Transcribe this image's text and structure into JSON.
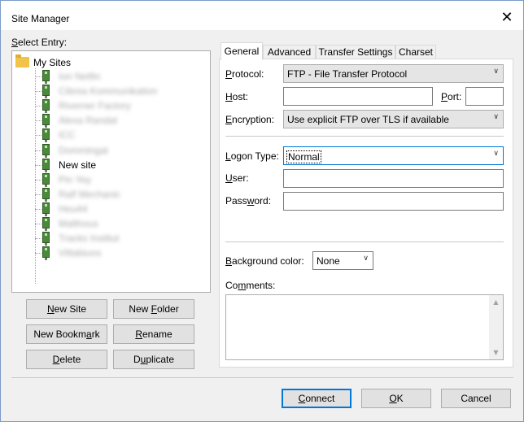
{
  "window": {
    "title": "Site Manager"
  },
  "tree": {
    "label": "Select Entry:",
    "root": "My Sites",
    "items": [
      {
        "label": "Ion Netfin",
        "blurred": true
      },
      {
        "label": "Cibrea Kommunikation",
        "blurred": true
      },
      {
        "label": "Riverner Factory",
        "blurred": true
      },
      {
        "label": "Alexa Randat",
        "blurred": true
      },
      {
        "label": "ICC",
        "blurred": true
      },
      {
        "label": "Dommingal",
        "blurred": true
      },
      {
        "label": "New site",
        "blurred": false
      },
      {
        "label": "Pin Yey",
        "blurred": true
      },
      {
        "label": "Ralf Mechanic",
        "blurred": true
      },
      {
        "label": "Heu44",
        "blurred": true
      },
      {
        "label": "Malthous",
        "blurred": true
      },
      {
        "label": "Tracks Institut",
        "blurred": true
      },
      {
        "label": "Vittabiuos",
        "blurred": true
      }
    ]
  },
  "left_buttons": {
    "new_site": "New Site",
    "new_folder": "New Folder",
    "new_bookmark": "New Bookmark",
    "rename": "Rename",
    "delete": "Delete",
    "duplicate": "Duplicate"
  },
  "tabs": [
    "General",
    "Advanced",
    "Transfer Settings",
    "Charset"
  ],
  "general": {
    "protocol_label": "Protocol:",
    "protocol_value": "FTP - File Transfer Protocol",
    "host_label": "Host:",
    "host_value": "",
    "port_label": "Port:",
    "port_value": "",
    "encryption_label": "Encryption:",
    "encryption_value": "Use explicit FTP over TLS if available",
    "logon_type_label": "Logon Type:",
    "logon_type_value": "Normal",
    "user_label": "User:",
    "user_value": "",
    "password_label": "Password:",
    "password_value": "",
    "background_color_label": "Background color:",
    "background_color_value": "None",
    "comments_label": "Comments:"
  },
  "dialog_buttons": {
    "connect": "Connect",
    "ok": "OK",
    "cancel": "Cancel"
  },
  "colors": {
    "accent": "#0078d7",
    "site_icon": "#4a8a3a",
    "folder": "#f2c34b"
  },
  "icons": {
    "close": "close-icon",
    "folder": "folder-icon",
    "site": "server-icon"
  }
}
